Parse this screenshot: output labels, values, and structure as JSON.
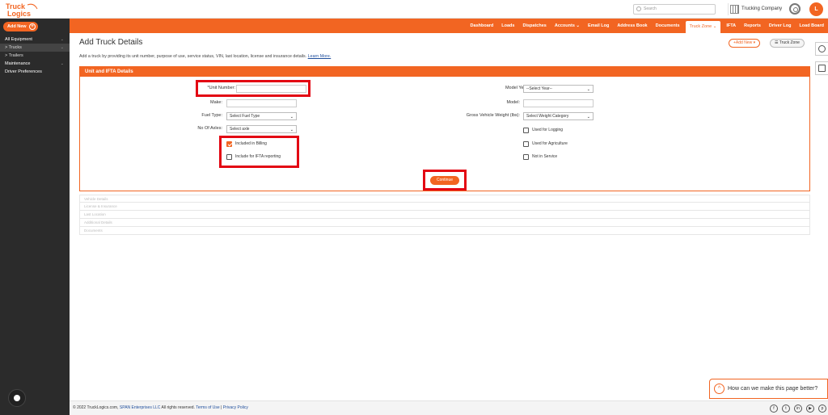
{
  "brand": {
    "logo_text": "TruckLogics",
    "accent": "#f26522",
    "highlight": "#e30613"
  },
  "header": {
    "search_placeholder": "Search",
    "company_name": "Trucking Company",
    "avatar_initial": "L"
  },
  "sidebar": {
    "add_new_label": "Add New",
    "items": [
      {
        "label": "All Equipment",
        "chevron": "⌄"
      },
      {
        "label": "> Trucks",
        "chevron": "⌄"
      },
      {
        "label": "> Trailers",
        "chevron": ""
      },
      {
        "label": "Maintenance",
        "chevron": "⌄"
      },
      {
        "label": "Driver Preferences",
        "chevron": ""
      }
    ]
  },
  "nav": {
    "items": [
      "Dashboard",
      "Loads",
      "Dispatches",
      "Accounts ⌄",
      "Email Log",
      "Address Book",
      "Documents",
      "Truck Zone ⌄",
      "IFTA",
      "Reports",
      "Driver Log",
      "Load Board"
    ],
    "active_index": 7
  },
  "page": {
    "title": "Add Truck Details",
    "description": "Add a truck by providing its unit number, purpose of use, service status, VIN, last location, license and insurance details.",
    "learn_more": "Learn More.",
    "add_new_button": "+Add New ▾",
    "truck_zone_button": "☰ Truck Zone"
  },
  "form": {
    "panel_title": "Unit and IFTA Details",
    "unit_number_label": "*Unit Number:",
    "make_label": "Make:",
    "fuel_type_label": "Fuel Type:",
    "fuel_type_value": "Select Fuel Type",
    "axles_label": "No Of Axles:",
    "axles_value": "Select axle",
    "model_year_label": "Model Year:",
    "model_year_value": "--Select Year--",
    "model_label": "Model:",
    "gvw_label": "Gross Vehicle Weight (lbs):",
    "gvw_value": "Select Weight Category",
    "checkboxes_left": [
      {
        "label": "Included in Billing",
        "checked": true
      },
      {
        "label": "Include for IFTA reporting",
        "checked": false
      }
    ],
    "checkboxes_right": [
      {
        "label": "Used for Logging",
        "checked": false
      },
      {
        "label": "Used for Agriculture",
        "checked": false
      },
      {
        "label": "Not in Service",
        "checked": false
      }
    ],
    "continue_label": "Continue"
  },
  "sections": [
    "Vehicle Details",
    "License & Insurance",
    "Last Location",
    "Additional Details",
    "Documents"
  ],
  "feedback": {
    "label": "How can we make this page better?"
  },
  "footer": {
    "copyright": "© 2022 TruckLogics.com,",
    "company": "SPAN Enterprises LLC",
    "rights": "All rights reserved.",
    "terms": "Terms of Use",
    "privacy": "Privacy Policy",
    "social": [
      "f",
      "t",
      "in",
      "▶",
      "p"
    ]
  }
}
